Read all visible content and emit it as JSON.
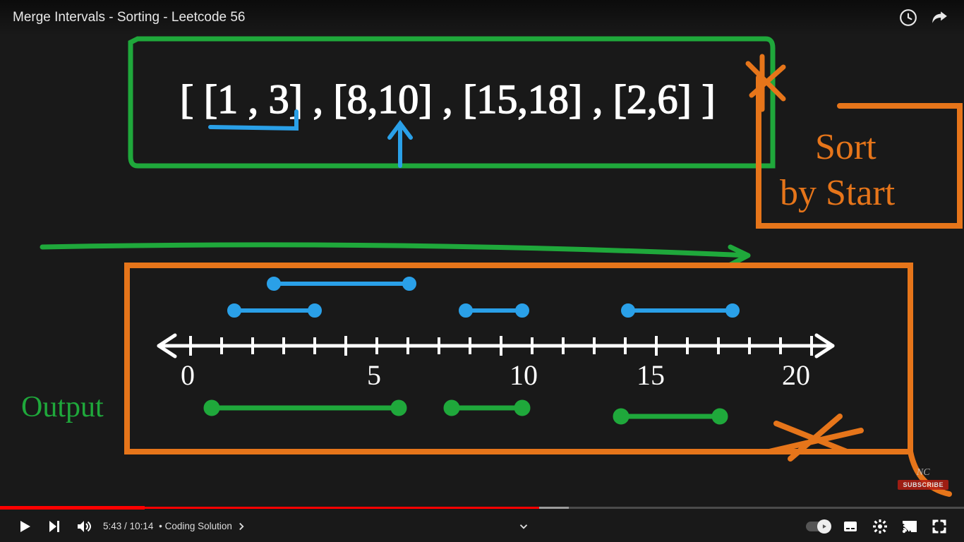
{
  "video": {
    "title": "Merge Intervals - Sorting - Leetcode 56",
    "current_time": "5:43",
    "duration": "10:14",
    "chapter_label": "Coding Solution",
    "progress_played_pct": 55.9,
    "progress_loaded_pct": 59,
    "progress_skip_pct": 15
  },
  "overlay": {
    "subscribe_brand": "NC",
    "subscribe_label": "SUBSCRIBE"
  },
  "whiteboard": {
    "input_intervals_text": "[ [1,3] , [8,10] , [15,18] , [2,6] ]",
    "input_intervals": [
      [
        1,
        3
      ],
      [
        8,
        10
      ],
      [
        15,
        18
      ],
      [
        2,
        6
      ]
    ],
    "annotation_sort": "Sort\nby Start",
    "output_label": "Output",
    "number_line": {
      "min": 0,
      "max": 20,
      "tick_labels": [
        "0",
        "5",
        "10",
        "15",
        "20"
      ]
    },
    "drawn_segments_blue": [
      [
        1,
        3
      ],
      [
        2,
        6
      ],
      [
        8,
        10
      ],
      [
        15,
        18
      ]
    ],
    "drawn_segments_green_output": [
      [
        1,
        6
      ],
      [
        8,
        10
      ],
      [
        15,
        18
      ]
    ]
  },
  "icons": {
    "watch_later": "watch-later-icon",
    "share": "share-icon",
    "play": "play-icon",
    "next": "next-icon",
    "volume": "volume-icon",
    "subtitles": "subtitles-icon",
    "settings": "settings-icon",
    "cast": "cast-icon",
    "theater": "theater-icon",
    "fullscreen": "fullscreen-icon"
  }
}
